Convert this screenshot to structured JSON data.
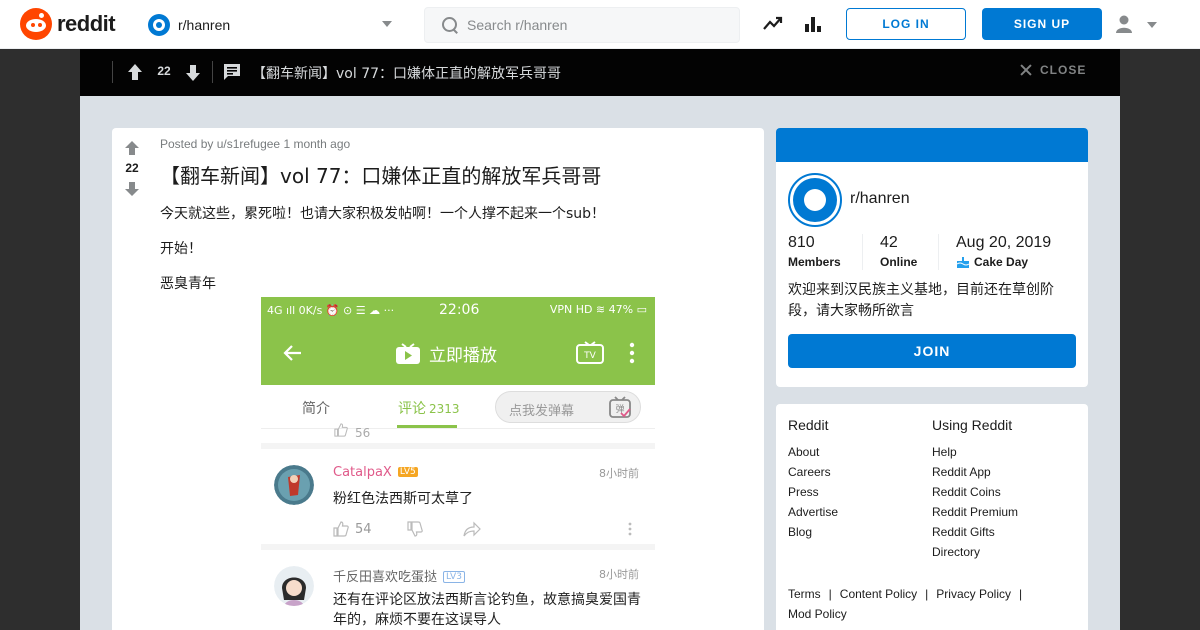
{
  "header": {
    "logo_text": "reddit",
    "subreddit": "r/hanren",
    "search_placeholder": "Search r/hanren",
    "login_label": "LOG IN",
    "signup_label": "SIGN UP",
    "brand_color": "#ff4500",
    "accent_color": "#0079d3"
  },
  "post_bar": {
    "score": "22",
    "title": "【翻车新闻】vol 77：口嫌体正直的解放军兵哥哥",
    "close_label": "CLOSE"
  },
  "post": {
    "score": "22",
    "posted_by": "Posted by",
    "author": "u/s1refugee",
    "time": "1 month ago",
    "title": "【翻车新闻】vol 77：口嫌体正直的解放军兵哥哥",
    "paragraphs": [
      "今天就这些，累死啦！也请大家积极发帖啊！一个人撑不起来一个sub！",
      "开始！",
      "恶臭青年"
    ]
  },
  "screenshot": {
    "status_left": "4G ıll  0K/s ⏰ ⊙ ☰ ☁ ···",
    "time": "22:06",
    "status_right": "VPN HD ≋ 47% ▭",
    "play_label": "立即播放",
    "tab_intro": "简介",
    "tab_comments": "评论",
    "comment_count": "2313",
    "danmu_placeholder": "点我发弹幕",
    "partial_like": "56",
    "comments": [
      {
        "name": "CatalpaX",
        "badge": "LV5",
        "time": "8小时前",
        "text": "粉红色法西斯可太草了",
        "likes": "54",
        "name_color": "#e05a8a"
      },
      {
        "name": "千反田喜欢吃蛋挞",
        "badge": "LV3",
        "time": "8小时前",
        "text": "还有在评论区放法西斯言论钓鱼，故意搞臭爱国青年的，麻烦不要在这误导人",
        "likes": "",
        "name_color": "#666666"
      }
    ]
  },
  "about": {
    "name": "r/hanren",
    "members": "810",
    "members_label": "Members",
    "online": "42",
    "online_label": "Online",
    "cake_day": "Aug 20, 2019",
    "cake_label": "Cake Day",
    "description": "欢迎来到汉民族主义基地，目前还在草创阶段，请大家畅所欲言",
    "join_label": "JOIN"
  },
  "footer_links": {
    "col1_title": "Reddit",
    "col1": [
      "About",
      "Careers",
      "Press",
      "Advertise",
      "Blog"
    ],
    "col2_title": "Using Reddit",
    "col2": [
      "Help",
      "Reddit App",
      "Reddit Coins",
      "Reddit Premium",
      "Reddit Gifts",
      "Directory"
    ],
    "bottom": [
      "Terms",
      "Content Policy",
      "Privacy Policy",
      "Mod Policy"
    ]
  }
}
